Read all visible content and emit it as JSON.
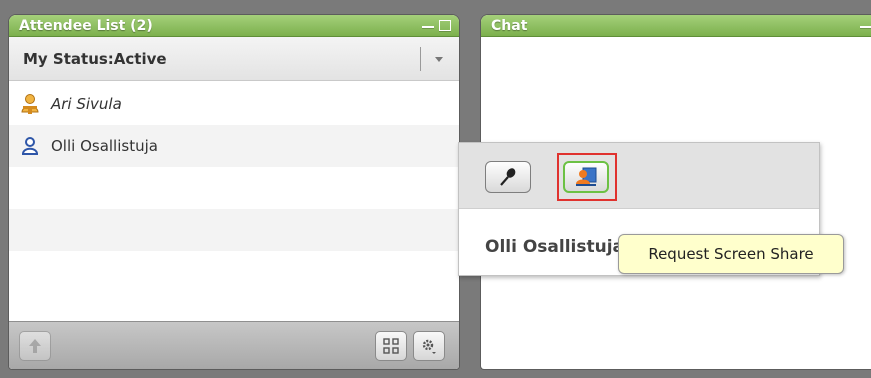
{
  "attendee_panel": {
    "title": "Attendee List (2)",
    "status_label": "My Status:Active"
  },
  "chat_panel": {
    "title": "Chat"
  },
  "attendees": [
    {
      "name": "Ari Sivula",
      "role": "presenter",
      "icon": "presenter-icon",
      "icon_color": "#e8a030"
    },
    {
      "name": "Olli Osallistuja",
      "role": "participant",
      "icon": "participant-icon",
      "icon_color": "#3a62b8"
    }
  ],
  "popup": {
    "name": "Olli Osallistuja",
    "buttons": [
      {
        "icon": "microphone-icon"
      },
      {
        "icon": "screen-share-icon"
      }
    ]
  },
  "tooltip": {
    "text": "Request Screen Share"
  },
  "colors": {
    "title_bar_green": "#8bbf5c",
    "highlight_red": "#e0322e",
    "tooltip_yellow": "#ffffcc"
  }
}
